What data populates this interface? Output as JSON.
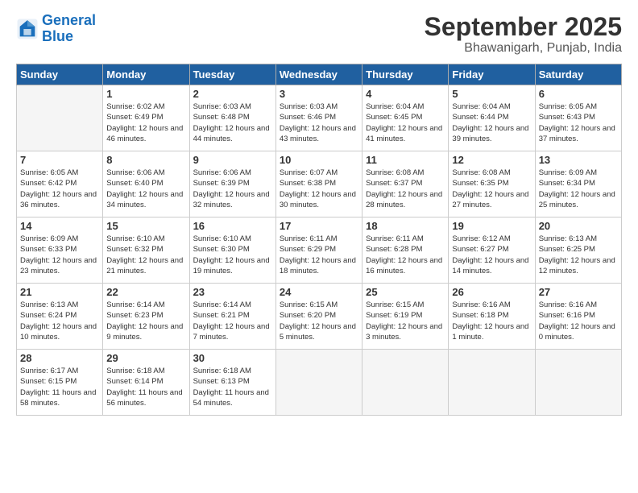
{
  "logo": {
    "text_general": "General",
    "text_blue": "Blue"
  },
  "title": "September 2025",
  "location": "Bhawanigarh, Punjab, India",
  "headers": [
    "Sunday",
    "Monday",
    "Tuesday",
    "Wednesday",
    "Thursday",
    "Friday",
    "Saturday"
  ],
  "weeks": [
    [
      {
        "day": "",
        "sunrise": "",
        "sunset": "",
        "daylight": ""
      },
      {
        "day": "1",
        "sunrise": "Sunrise: 6:02 AM",
        "sunset": "Sunset: 6:49 PM",
        "daylight": "Daylight: 12 hours and 46 minutes."
      },
      {
        "day": "2",
        "sunrise": "Sunrise: 6:03 AM",
        "sunset": "Sunset: 6:48 PM",
        "daylight": "Daylight: 12 hours and 44 minutes."
      },
      {
        "day": "3",
        "sunrise": "Sunrise: 6:03 AM",
        "sunset": "Sunset: 6:46 PM",
        "daylight": "Daylight: 12 hours and 43 minutes."
      },
      {
        "day": "4",
        "sunrise": "Sunrise: 6:04 AM",
        "sunset": "Sunset: 6:45 PM",
        "daylight": "Daylight: 12 hours and 41 minutes."
      },
      {
        "day": "5",
        "sunrise": "Sunrise: 6:04 AM",
        "sunset": "Sunset: 6:44 PM",
        "daylight": "Daylight: 12 hours and 39 minutes."
      },
      {
        "day": "6",
        "sunrise": "Sunrise: 6:05 AM",
        "sunset": "Sunset: 6:43 PM",
        "daylight": "Daylight: 12 hours and 37 minutes."
      }
    ],
    [
      {
        "day": "7",
        "sunrise": "Sunrise: 6:05 AM",
        "sunset": "Sunset: 6:42 PM",
        "daylight": "Daylight: 12 hours and 36 minutes."
      },
      {
        "day": "8",
        "sunrise": "Sunrise: 6:06 AM",
        "sunset": "Sunset: 6:40 PM",
        "daylight": "Daylight: 12 hours and 34 minutes."
      },
      {
        "day": "9",
        "sunrise": "Sunrise: 6:06 AM",
        "sunset": "Sunset: 6:39 PM",
        "daylight": "Daylight: 12 hours and 32 minutes."
      },
      {
        "day": "10",
        "sunrise": "Sunrise: 6:07 AM",
        "sunset": "Sunset: 6:38 PM",
        "daylight": "Daylight: 12 hours and 30 minutes."
      },
      {
        "day": "11",
        "sunrise": "Sunrise: 6:08 AM",
        "sunset": "Sunset: 6:37 PM",
        "daylight": "Daylight: 12 hours and 28 minutes."
      },
      {
        "day": "12",
        "sunrise": "Sunrise: 6:08 AM",
        "sunset": "Sunset: 6:35 PM",
        "daylight": "Daylight: 12 hours and 27 minutes."
      },
      {
        "day": "13",
        "sunrise": "Sunrise: 6:09 AM",
        "sunset": "Sunset: 6:34 PM",
        "daylight": "Daylight: 12 hours and 25 minutes."
      }
    ],
    [
      {
        "day": "14",
        "sunrise": "Sunrise: 6:09 AM",
        "sunset": "Sunset: 6:33 PM",
        "daylight": "Daylight: 12 hours and 23 minutes."
      },
      {
        "day": "15",
        "sunrise": "Sunrise: 6:10 AM",
        "sunset": "Sunset: 6:32 PM",
        "daylight": "Daylight: 12 hours and 21 minutes."
      },
      {
        "day": "16",
        "sunrise": "Sunrise: 6:10 AM",
        "sunset": "Sunset: 6:30 PM",
        "daylight": "Daylight: 12 hours and 19 minutes."
      },
      {
        "day": "17",
        "sunrise": "Sunrise: 6:11 AM",
        "sunset": "Sunset: 6:29 PM",
        "daylight": "Daylight: 12 hours and 18 minutes."
      },
      {
        "day": "18",
        "sunrise": "Sunrise: 6:11 AM",
        "sunset": "Sunset: 6:28 PM",
        "daylight": "Daylight: 12 hours and 16 minutes."
      },
      {
        "day": "19",
        "sunrise": "Sunrise: 6:12 AM",
        "sunset": "Sunset: 6:27 PM",
        "daylight": "Daylight: 12 hours and 14 minutes."
      },
      {
        "day": "20",
        "sunrise": "Sunrise: 6:13 AM",
        "sunset": "Sunset: 6:25 PM",
        "daylight": "Daylight: 12 hours and 12 minutes."
      }
    ],
    [
      {
        "day": "21",
        "sunrise": "Sunrise: 6:13 AM",
        "sunset": "Sunset: 6:24 PM",
        "daylight": "Daylight: 12 hours and 10 minutes."
      },
      {
        "day": "22",
        "sunrise": "Sunrise: 6:14 AM",
        "sunset": "Sunset: 6:23 PM",
        "daylight": "Daylight: 12 hours and 9 minutes."
      },
      {
        "day": "23",
        "sunrise": "Sunrise: 6:14 AM",
        "sunset": "Sunset: 6:21 PM",
        "daylight": "Daylight: 12 hours and 7 minutes."
      },
      {
        "day": "24",
        "sunrise": "Sunrise: 6:15 AM",
        "sunset": "Sunset: 6:20 PM",
        "daylight": "Daylight: 12 hours and 5 minutes."
      },
      {
        "day": "25",
        "sunrise": "Sunrise: 6:15 AM",
        "sunset": "Sunset: 6:19 PM",
        "daylight": "Daylight: 12 hours and 3 minutes."
      },
      {
        "day": "26",
        "sunrise": "Sunrise: 6:16 AM",
        "sunset": "Sunset: 6:18 PM",
        "daylight": "Daylight: 12 hours and 1 minute."
      },
      {
        "day": "27",
        "sunrise": "Sunrise: 6:16 AM",
        "sunset": "Sunset: 6:16 PM",
        "daylight": "Daylight: 12 hours and 0 minutes."
      }
    ],
    [
      {
        "day": "28",
        "sunrise": "Sunrise: 6:17 AM",
        "sunset": "Sunset: 6:15 PM",
        "daylight": "Daylight: 11 hours and 58 minutes."
      },
      {
        "day": "29",
        "sunrise": "Sunrise: 6:18 AM",
        "sunset": "Sunset: 6:14 PM",
        "daylight": "Daylight: 11 hours and 56 minutes."
      },
      {
        "day": "30",
        "sunrise": "Sunrise: 6:18 AM",
        "sunset": "Sunset: 6:13 PM",
        "daylight": "Daylight: 11 hours and 54 minutes."
      },
      {
        "day": "",
        "sunrise": "",
        "sunset": "",
        "daylight": ""
      },
      {
        "day": "",
        "sunrise": "",
        "sunset": "",
        "daylight": ""
      },
      {
        "day": "",
        "sunrise": "",
        "sunset": "",
        "daylight": ""
      },
      {
        "day": "",
        "sunrise": "",
        "sunset": "",
        "daylight": ""
      }
    ]
  ]
}
